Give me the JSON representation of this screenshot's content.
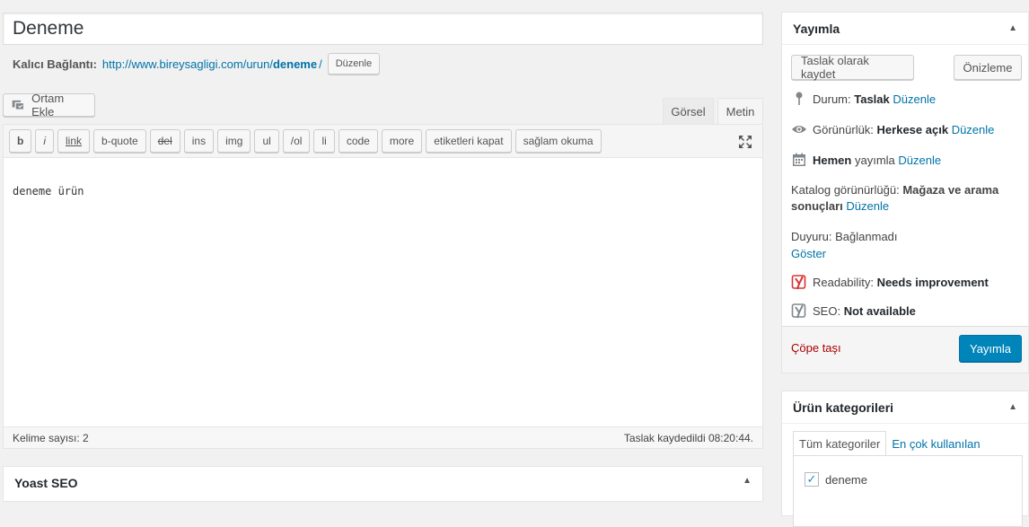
{
  "title": {
    "value": "Deneme"
  },
  "permalink": {
    "label": "Kalıcı Bağlantı:",
    "url_base": "http://www.bireysagligi.com/urun/",
    "slug": "deneme",
    "url_tail": "/",
    "edit_label": "Düzenle"
  },
  "media_button": {
    "label": "Ortam Ekle"
  },
  "tabs": {
    "visual": "Görsel",
    "text": "Metin"
  },
  "toolbar": {
    "buttons": [
      "b",
      "i",
      "link",
      "b-quote",
      "del",
      "ins",
      "img",
      "ul",
      "/ol",
      "li",
      "code",
      "more",
      "etiketleri kapat",
      "sağlam okuma"
    ]
  },
  "editor": {
    "content": "deneme ürün",
    "word_count": "Kelime sayısı: 2",
    "saved_status": "Taslak kaydedildi 08:20:44."
  },
  "yoast_box": {
    "title": "Yoast SEO"
  },
  "publish": {
    "title": "Yayımla",
    "save_draft": "Taslak olarak kaydet",
    "preview": "Önizleme",
    "status_label": "Durum:",
    "status_value": "Taslak",
    "visibility_label": "Görünürlük:",
    "visibility_value": "Herkese açık",
    "schedule_value": "Hemen",
    "schedule_label": "yayımla",
    "catalog_label": "Katalog görünürlüğü:",
    "catalog_value_1": "Mağaza ve arama",
    "catalog_value_2": "sonuçları",
    "featured_label": "Duyuru: Bağlanmadı",
    "featured_show": "Göster",
    "readability_label": "Readability:",
    "readability_value": "Needs improvement",
    "seo_label": "SEO:",
    "seo_value": "Not available",
    "edit": "Düzenle",
    "trash": "Çöpe taşı",
    "publish_button": "Yayımla"
  },
  "categories": {
    "title": "Ürün kategorileri",
    "tab_all": "Tüm kategoriler",
    "tab_popular": "En çok kullanılan",
    "items": [
      {
        "label": "deneme",
        "checked": true
      }
    ]
  },
  "colors": {
    "link": "#0073aa",
    "primary_button": "#0085ba",
    "trash": "#a00000",
    "yoast_red": "#dc3232"
  }
}
